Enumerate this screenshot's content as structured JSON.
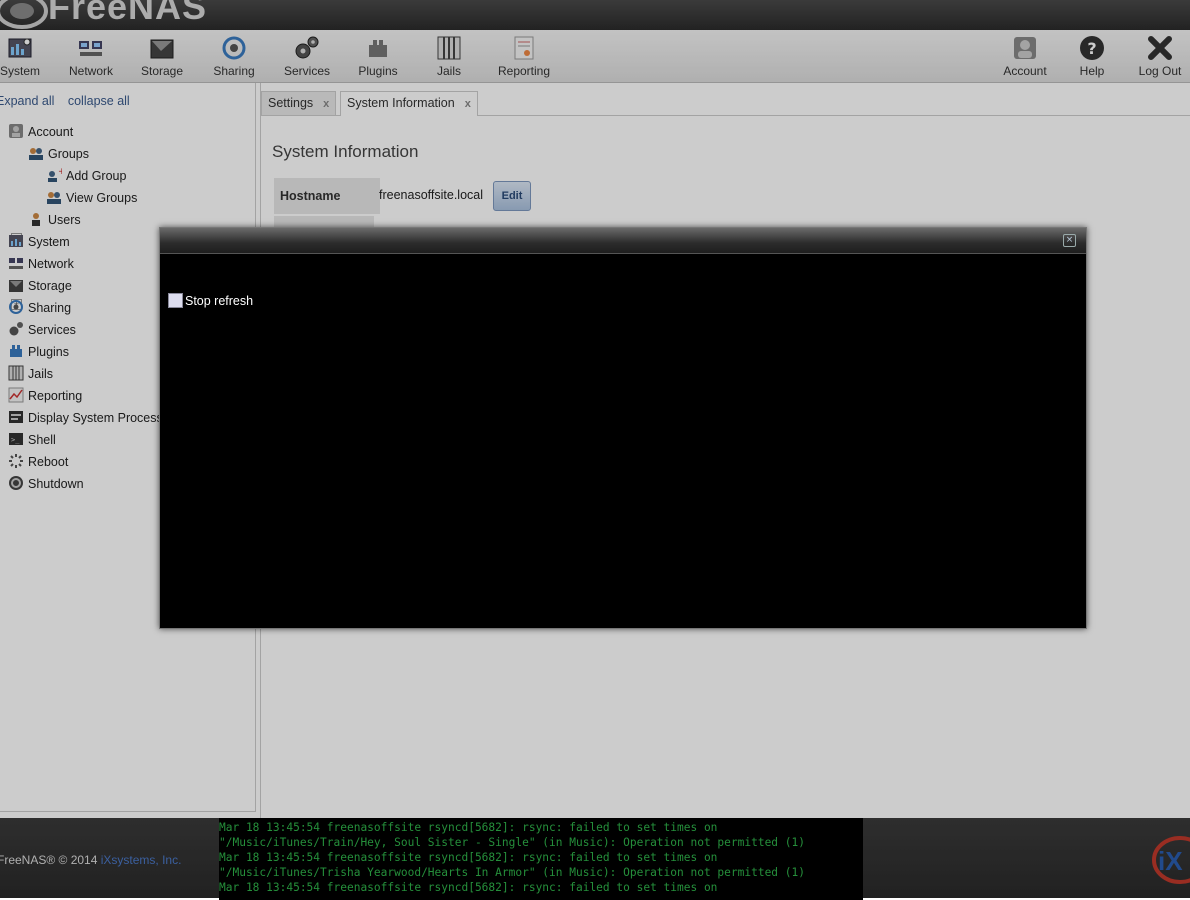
{
  "app": {
    "logo_text": "FreeNAS"
  },
  "toolbar": {
    "left": [
      {
        "label": "System",
        "icon": "system-icon"
      },
      {
        "label": "Network",
        "icon": "network-icon"
      },
      {
        "label": "Storage",
        "icon": "storage-icon"
      },
      {
        "label": "Sharing",
        "icon": "sharing-icon"
      },
      {
        "label": "Services",
        "icon": "services-icon"
      },
      {
        "label": "Plugins",
        "icon": "plugins-icon"
      },
      {
        "label": "Jails",
        "icon": "jails-icon"
      },
      {
        "label": "Reporting",
        "icon": "reporting-icon"
      }
    ],
    "right": [
      {
        "label": "Account",
        "icon": "account-icon"
      },
      {
        "label": "Help",
        "icon": "help-icon"
      },
      {
        "label": "Log Out",
        "icon": "logout-icon"
      }
    ]
  },
  "sidebar": {
    "expand_all": "Expand all",
    "collapse_all": "collapse all",
    "tree": [
      {
        "label": "Account",
        "icon": "account-icon"
      },
      {
        "label": "Groups",
        "icon": "groups-icon"
      },
      {
        "label": "Add Group",
        "icon": "add-group-icon"
      },
      {
        "label": "View Groups",
        "icon": "view-groups-icon"
      },
      {
        "label": "Users",
        "icon": "users-icon"
      },
      {
        "label": "System",
        "icon": "system-icon"
      },
      {
        "label": "Network",
        "icon": "network-icon"
      },
      {
        "label": "Storage",
        "icon": "storage-icon"
      },
      {
        "label": "Sharing",
        "icon": "sharing-icon"
      },
      {
        "label": "Services",
        "icon": "services-icon"
      },
      {
        "label": "Plugins",
        "icon": "plugins-icon"
      },
      {
        "label": "Jails",
        "icon": "jails-icon"
      },
      {
        "label": "Reporting",
        "icon": "reporting-icon"
      },
      {
        "label": "Display System Processes",
        "icon": "processes-icon"
      },
      {
        "label": "Shell",
        "icon": "shell-icon"
      },
      {
        "label": "Reboot",
        "icon": "reboot-icon"
      },
      {
        "label": "Shutdown",
        "icon": "shutdown-icon"
      }
    ]
  },
  "tabs": [
    {
      "label": "Settings",
      "close": "x"
    },
    {
      "label": "System Information",
      "close": "x"
    }
  ],
  "main": {
    "title": "System Information",
    "hostname_label": "Hostname",
    "hostname_value": "freenasoffsite.local",
    "edit_label": "Edit"
  },
  "modal": {
    "close_glyph": "×",
    "stop_refresh_label": "Stop refresh"
  },
  "footer": {
    "copyright": "FreeNAS® © 2014",
    "company": "iXsystems, Inc."
  },
  "console": {
    "lines": [
      "Mar 18 13:45:54 freenasoffsite rsyncd[5682]: rsync: failed to set times on",
      "\"/Music/iTunes/Train/Hey, Soul Sister - Single\" (in Music): Operation not permitted (1)",
      "Mar 18 13:45:54 freenasoffsite rsyncd[5682]: rsync: failed to set times on",
      "\"/Music/iTunes/Trisha Yearwood/Hearts In Armor\" (in Music): Operation not permitted (1)",
      "Mar 18 13:45:54 freenasoffsite rsyncd[5682]: rsync: failed to set times on"
    ]
  },
  "colors": {
    "accent_link": "#3a5a8c",
    "console_text": "#2fb34a",
    "header_bg": "#2b2b2b"
  }
}
